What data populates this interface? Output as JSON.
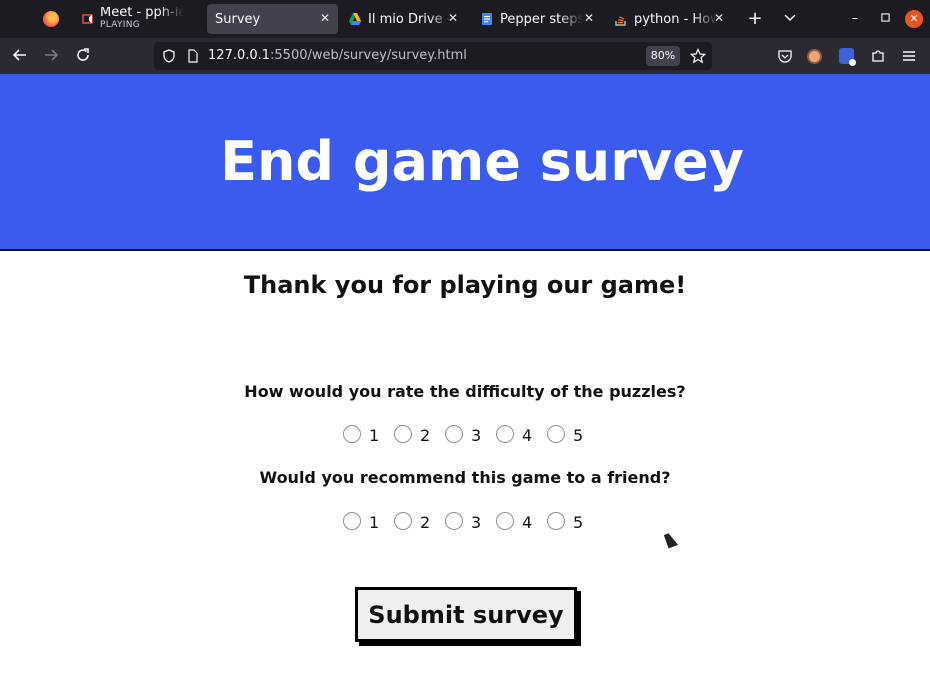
{
  "browser": {
    "tabs": [
      {
        "label": "",
        "icon": "firefox-icon"
      },
      {
        "label": "Meet - pph-iek",
        "sub": "PLAYING",
        "icon": "meet-icon"
      },
      {
        "label": "Survey",
        "active": true
      },
      {
        "label": "Il mio Drive - G",
        "icon": "drive-icon"
      },
      {
        "label": "Pepper steps",
        "icon": "docs-icon"
      },
      {
        "label": "python - How",
        "icon": "stackoverflow-icon"
      }
    ],
    "new_tab": "+",
    "url_host": "127.0.0.1",
    "url_rest": ":5500/web/survey/survey.html",
    "zoom": "80%"
  },
  "page": {
    "title": "End game survey",
    "thanks": "Thank you for playing our game!",
    "questions": [
      {
        "text": "How would you rate the difficulty of the puzzles?",
        "options": [
          "1",
          "2",
          "3",
          "4",
          "5"
        ]
      },
      {
        "text": "Would you recommend this game to a friend?",
        "options": [
          "1",
          "2",
          "3",
          "4",
          "5"
        ]
      }
    ],
    "submit_label": "Submit survey"
  },
  "colors": {
    "banner": "#3b5bef",
    "chrome_dark": "#1c1b22",
    "toolbar": "#2b2a33"
  }
}
